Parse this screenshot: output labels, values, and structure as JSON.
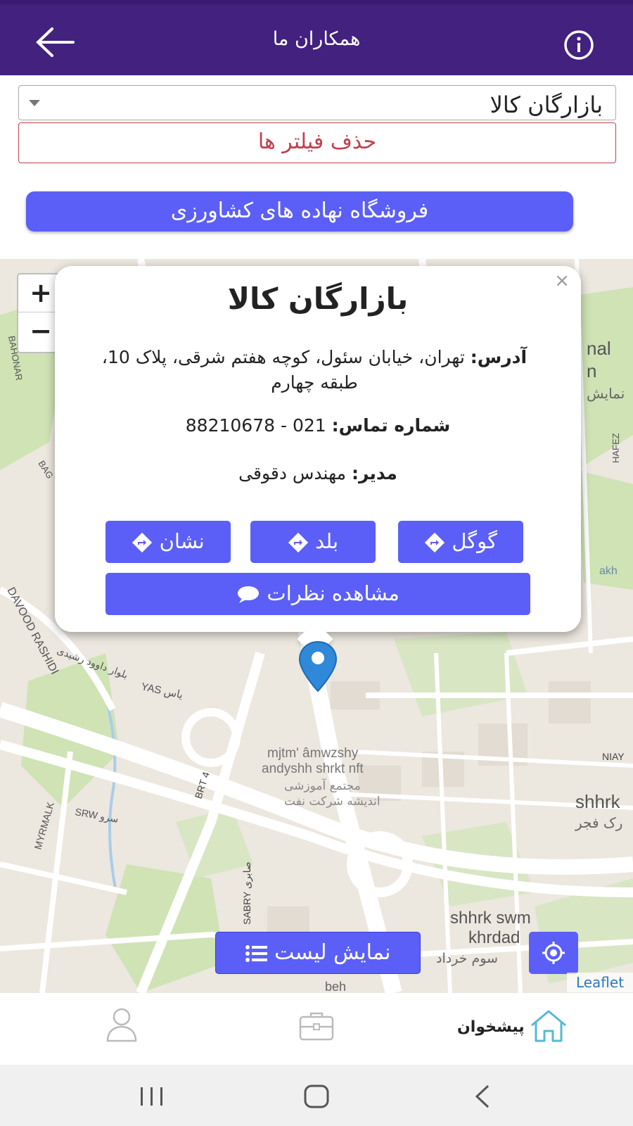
{
  "header": {
    "title": "همکاران ما",
    "back_icon": "arrow-left-icon",
    "info_icon": "info-circle-icon",
    "bg_color": "#43217e"
  },
  "filter": {
    "selected_value": "بازارگان کالا",
    "clear_label": "حذف فیلتر ها"
  },
  "category_button": {
    "label": "فروشگاه نهاده های کشاورزی"
  },
  "map": {
    "zoom_in": "+",
    "zoom_out": "−",
    "attribution": "Leaflet",
    "labels": {
      "nal": "nal",
      "n": "n",
      "namayesh": "نمایش",
      "davood": "DAVOOD RASHIDI",
      "davood_fa": "بلوار داوود رشیدی",
      "yas": "YAS یاس",
      "brt": "BRT 4",
      "mjtm": "mjtm' âmwzshy",
      "andysh": "andyshh shrkt nft",
      "mojtama": "مجتمع آموزشی",
      "andisheh": "اندیشه شرکت نفت",
      "myrmalk": "MYRMALK",
      "srw": "SRW سرو",
      "shhrk": "shhrk",
      "fajr": "رک فجر",
      "niay": "NIAY",
      "sabry": "SABRY صابری",
      "shhrk_swm": "shhrk swm",
      "khrdad": "khrdad",
      "sevvom": "سوم خرداد",
      "beh": "beh",
      "hafez": "HAFEZ",
      "bagh": "BAG",
      "bahonar": "BAHONAR",
      "akh": "akh"
    },
    "locate_icon": "crosshair-icon",
    "marker_icon": "map-pin-icon"
  },
  "popup": {
    "title": "بازارگان کالا",
    "address_label": "آدرس:",
    "address_value": "تهران، خیابان سئول، کوچه هفتم شرقی، پلاک 10، طبقه چهارم",
    "phone_label": "شماره تماس:",
    "phone_value": "021 - 88210678",
    "manager_label": "مدیر:",
    "manager_value": "مهندس دقوقی",
    "close": "×",
    "buttons": {
      "google": "گوگل",
      "balad": "بلد",
      "neshan": "نشان",
      "reviews": "مشاهده نظرات"
    }
  },
  "list_button": {
    "label": "نمایش لیست"
  },
  "bottom_nav": {
    "home_label": "پیشخوان"
  },
  "accent_color": "#5b5ff7"
}
